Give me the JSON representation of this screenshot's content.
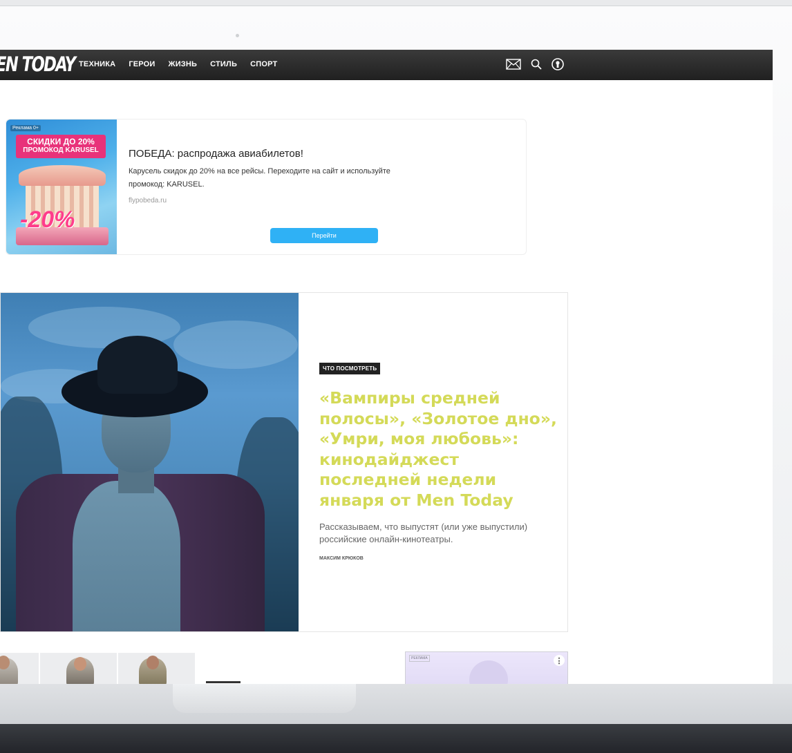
{
  "nav": {
    "logo": "EN TODAY",
    "menu": [
      "ТЕХНИКА",
      "ГЕРОИ",
      "ЖИЗНЬ",
      "СТИЛЬ",
      "СПОРТ"
    ],
    "icons": [
      "mail-icon",
      "search-icon",
      "user-icon"
    ]
  },
  "ad": {
    "tag": "Реклама 0+",
    "banner_line1": "СКИДКИ ДО 20%",
    "banner_line2": "ПРОМОКОД KARUSEL",
    "banner_pct": "-20%",
    "title": "ПОБЕДА: распродажа авиабилетов!",
    "description": "Карусель скидок до 20% на все рейсы. Переходите на сайт и используйте промокод: KARUSEL.",
    "domain": "flypobeda.ru",
    "button": "Перейти"
  },
  "hero": {
    "category": "ЧТО ПОСМОТРЕТЬ",
    "headline": "«Вампиры средней полосы», «Золотое дно», «Умри, моя любовь»: кинодайджест последней недели января от Men Today",
    "lead": "Рассказываем, что выпустят (или уже выпустили) российские онлайн-кинотеатры.",
    "author": "МАКСИМ КРЮКОВ"
  },
  "ad2": {
    "tag": "РЕКЛАМА",
    "menu": "⋮"
  },
  "colors": {
    "nav_bg": "#2b2b2b",
    "headline": "#d4da58",
    "ad_button": "#2fb1f5"
  }
}
